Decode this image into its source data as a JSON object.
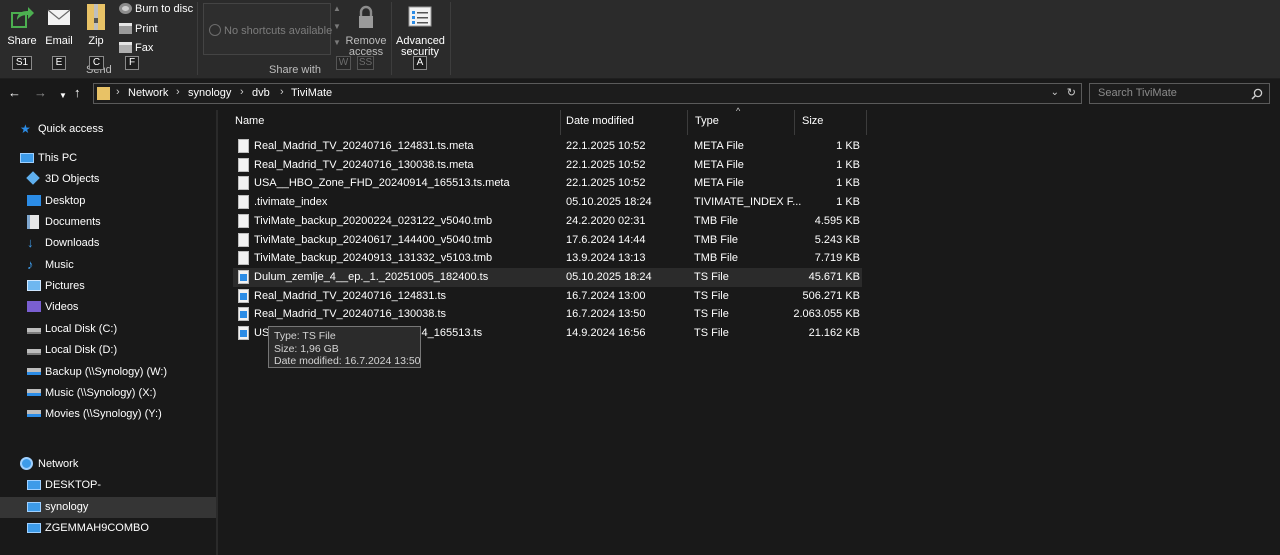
{
  "ribbon": {
    "buttons": [
      {
        "label": "Share",
        "key": "S1"
      },
      {
        "label": "Email",
        "key": "E"
      },
      {
        "label": "Zip",
        "key": "C"
      }
    ],
    "zip_sublabel": "Send",
    "small_items": [
      {
        "label": "Burn to disc"
      },
      {
        "label": "Print"
      },
      {
        "label": "Fax",
        "key": "F"
      }
    ],
    "shortcuts_placeholder": "No shortcuts available",
    "shortcut_keys": [
      "W",
      "SS"
    ],
    "share_with_label": "Share with",
    "remove_access_line1": "Remove",
    "remove_access_line2": "access",
    "advanced_security_line1": "Advanced",
    "advanced_security_line2": "security",
    "advanced_security_key": "A"
  },
  "address": {
    "breadcrumbs": [
      "Network",
      "synology",
      "dvb",
      "TiviMate"
    ],
    "separator": "›",
    "search_placeholder": "Search TiviMate"
  },
  "sidebar": {
    "items": [
      {
        "label": "Quick access",
        "icon": "star-icon"
      },
      {
        "label": "This PC",
        "icon": "pc-icon"
      },
      {
        "label": "3D Objects",
        "icon": "cube-icon"
      },
      {
        "label": "Desktop",
        "icon": "desktop-icon"
      },
      {
        "label": "Documents",
        "icon": "documents-icon"
      },
      {
        "label": "Downloads",
        "icon": "download-icon"
      },
      {
        "label": "Music",
        "icon": "music-icon"
      },
      {
        "label": "Pictures",
        "icon": "pictures-icon"
      },
      {
        "label": "Videos",
        "icon": "videos-icon"
      },
      {
        "label": "Local Disk (C:)",
        "icon": "drive-icon"
      },
      {
        "label": "Local Disk (D:)",
        "icon": "drive-icon"
      },
      {
        "label": "Backup (\\\\Synology) (W:)",
        "icon": "network-drive-icon"
      },
      {
        "label": "Music (\\\\Synology) (X:)",
        "icon": "network-drive-icon"
      },
      {
        "label": "Movies (\\\\Synology) (Y:)",
        "icon": "network-drive-icon"
      },
      {
        "label": "Network",
        "icon": "network-icon"
      },
      {
        "label": "DESKTOP-",
        "icon": "computer-icon"
      },
      {
        "label": "synology",
        "icon": "computer-icon"
      },
      {
        "label": "ZGEMMAH9COMBO",
        "icon": "computer-icon"
      }
    ]
  },
  "columns": {
    "name": "Name",
    "date": "Date modified",
    "type": "Type",
    "size": "Size"
  },
  "files": [
    {
      "name": "Real_Madrid_TV_20240716_124831.ts.meta",
      "date": "22.1.2025 10:52",
      "type": "META File",
      "size": "1 KB",
      "kind": "doc"
    },
    {
      "name": "Real_Madrid_TV_20240716_130038.ts.meta",
      "date": "22.1.2025 10:52",
      "type": "META File",
      "size": "1 KB",
      "kind": "doc"
    },
    {
      "name": "USA__HBO_Zone_FHD_20240914_165513.ts.meta",
      "date": "22.1.2025 10:52",
      "type": "META File",
      "size": "1 KB",
      "kind": "doc"
    },
    {
      "name": ".tivimate_index",
      "date": "05.10.2025 18:24",
      "type": "TIVIMATE_INDEX F...",
      "size": "1 KB",
      "kind": "doc"
    },
    {
      "name": "TiviMate_backup_20200224_023122_v5040.tmb",
      "date": "24.2.2020 02:31",
      "type": "TMB File",
      "size": "4.595 KB",
      "kind": "doc"
    },
    {
      "name": "TiviMate_backup_20240617_144400_v5040.tmb",
      "date": "17.6.2024 14:44",
      "type": "TMB File",
      "size": "5.243 KB",
      "kind": "doc"
    },
    {
      "name": "TiviMate_backup_20240913_131332_v5103.tmb",
      "date": "13.9.2024 13:13",
      "type": "TMB File",
      "size": "7.719 KB",
      "kind": "doc"
    },
    {
      "name": "Dulum_zemlje_4__ep._1._20251005_182400.ts",
      "date": "05.10.2025 18:24",
      "type": "TS File",
      "size": "45.671 KB",
      "kind": "ts"
    },
    {
      "name": "Real_Madrid_TV_20240716_124831.ts",
      "date": "16.7.2024 13:00",
      "type": "TS File",
      "size": "506.271 KB",
      "kind": "ts"
    },
    {
      "name": "Real_Madrid_TV_20240716_130038.ts",
      "date": "16.7.2024 13:50",
      "type": "TS File",
      "size": "2.063.055 KB",
      "kind": "ts"
    },
    {
      "name": "USA__HBO_Zone_FHD_20240914_165513.ts",
      "date": "14.9.2024 16:56",
      "type": "TS File",
      "size": "21.162 KB",
      "kind": "ts"
    }
  ],
  "hovered_row": 7,
  "tooltip": {
    "line1": "Type: TS File",
    "line2": "Size: 1,96 GB",
    "line3": "Date modified: 16.7.2024 13:50"
  },
  "colors": {
    "folder": "#e8c266",
    "accent": "#2b8ce6",
    "share_green": "#4caf50"
  }
}
